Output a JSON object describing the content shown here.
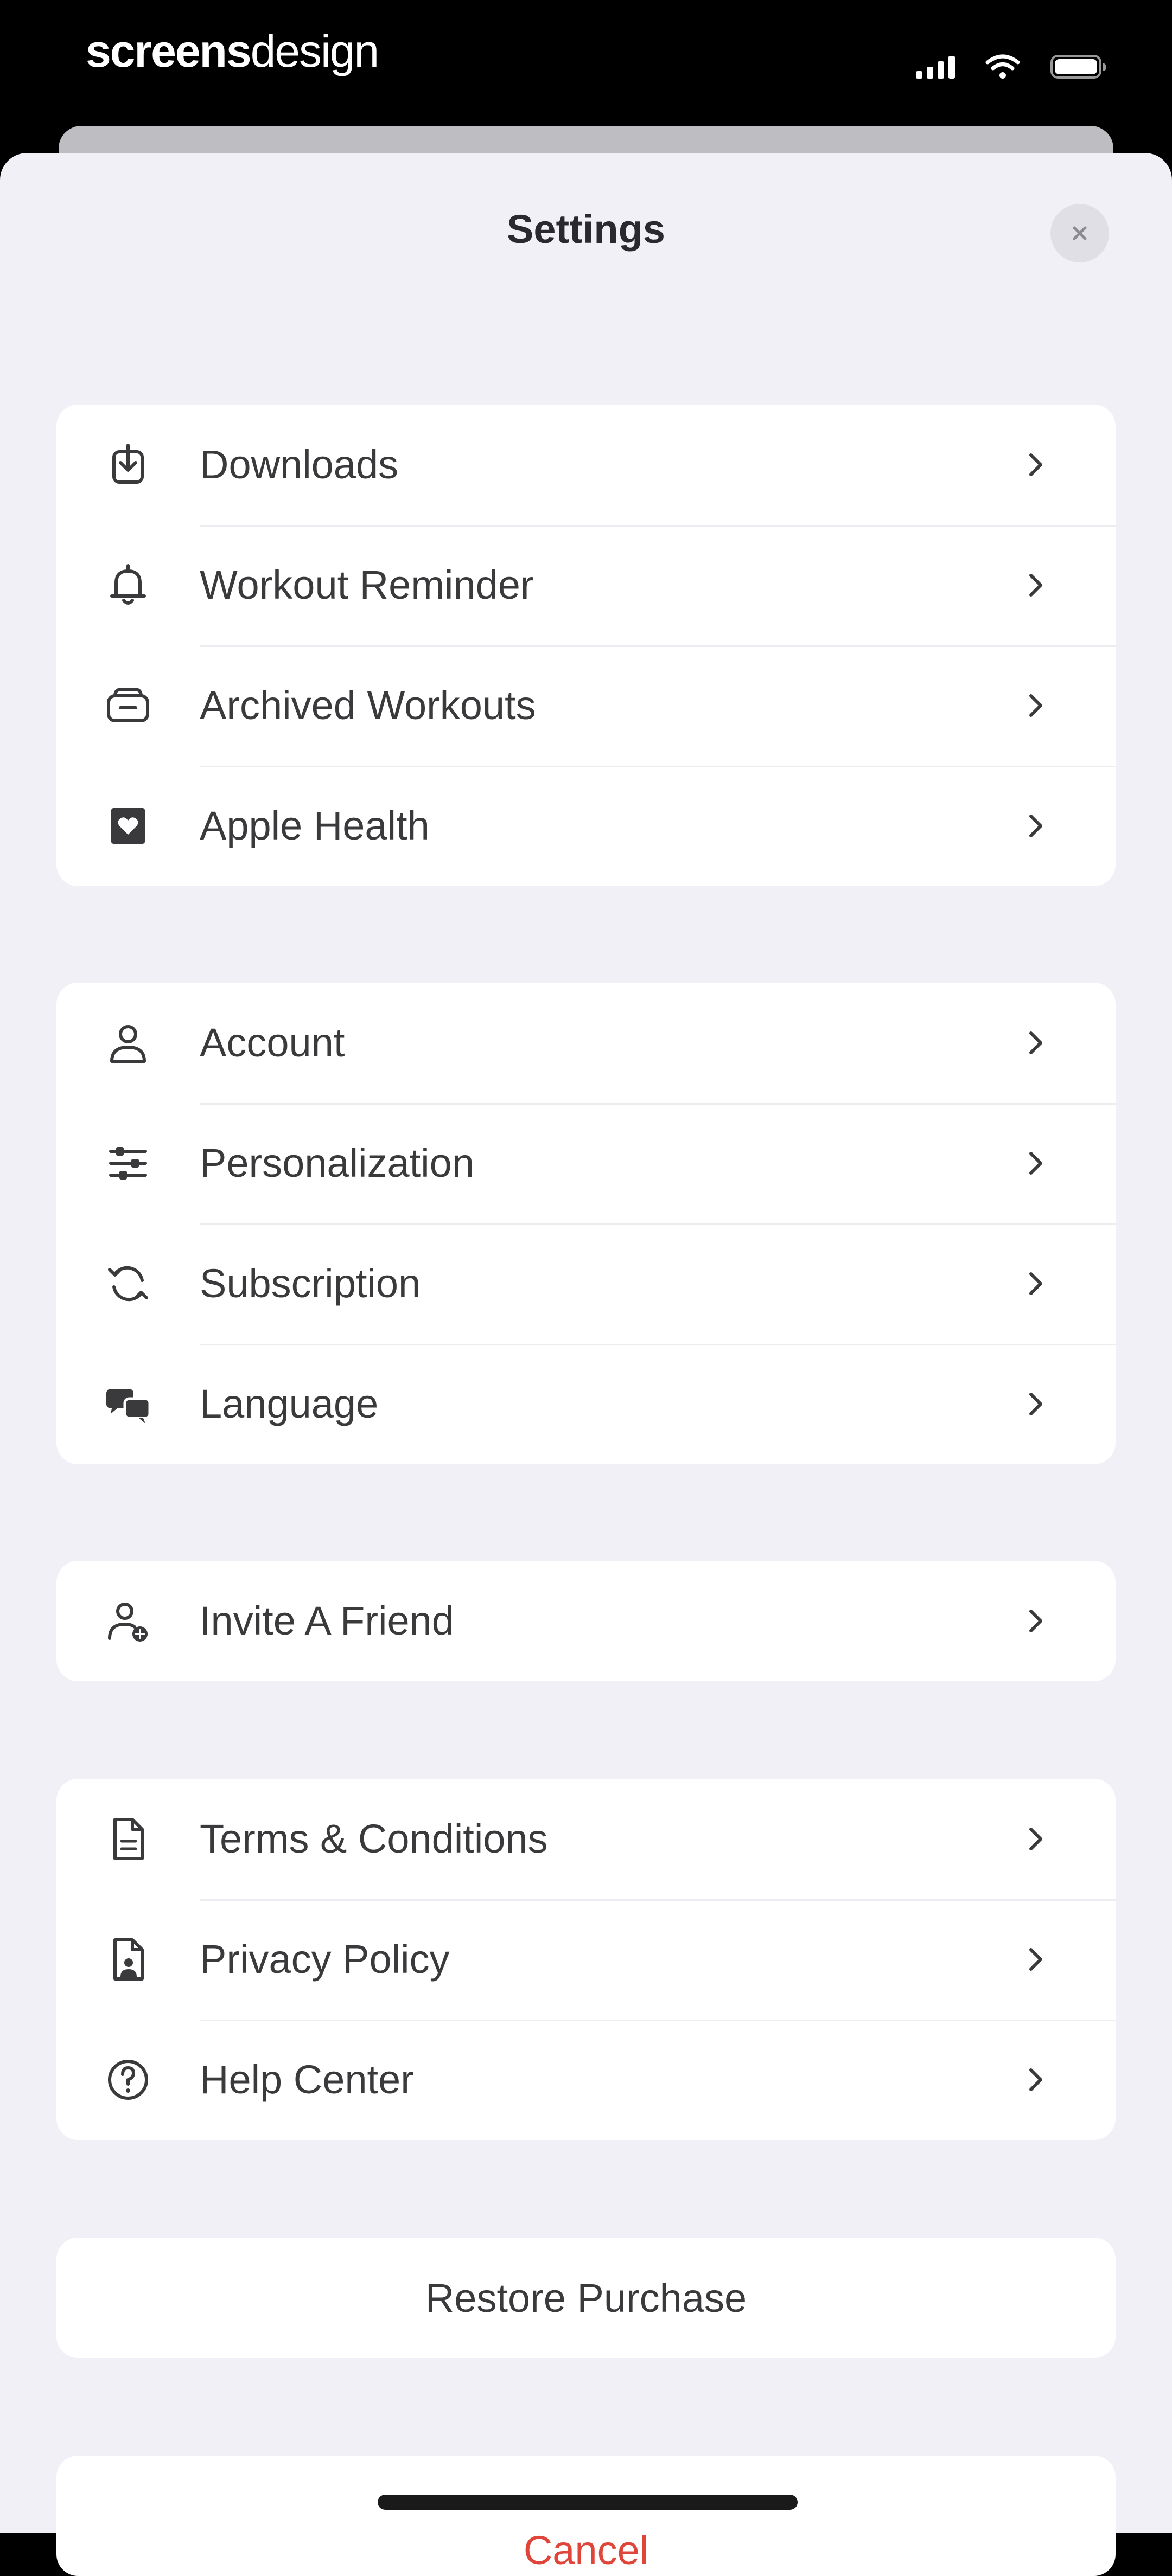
{
  "status_bar": {
    "brand_bold": "screens",
    "brand_light": "design"
  },
  "header": {
    "title": "Settings"
  },
  "groups": [
    {
      "items": [
        {
          "label": "Downloads",
          "icon": "download-icon"
        },
        {
          "label": "Workout Reminder",
          "icon": "bell-icon"
        },
        {
          "label": "Archived Workouts",
          "icon": "archive-box-icon"
        },
        {
          "label": "Apple Health",
          "icon": "heart-icon"
        }
      ]
    },
    {
      "items": [
        {
          "label": "Account",
          "icon": "person-icon"
        },
        {
          "label": "Personalization",
          "icon": "sliders-icon"
        },
        {
          "label": "Subscription",
          "icon": "refresh-icon"
        },
        {
          "label": "Language",
          "icon": "speech-bubbles-icon"
        }
      ]
    },
    {
      "items": [
        {
          "label": "Invite A Friend",
          "icon": "add-person-icon"
        }
      ]
    },
    {
      "items": [
        {
          "label": "Terms & Conditions",
          "icon": "document-icon"
        },
        {
          "label": "Privacy Policy",
          "icon": "privacy-document-icon"
        },
        {
          "label": "Help Center",
          "icon": "question-circle-icon"
        }
      ]
    }
  ],
  "restore_label": "Restore Purchase",
  "cancel_label": "Cancel",
  "colors": {
    "background": "#f1f0f7",
    "card": "#ffffff",
    "text": "#3a3a3c",
    "destructive": "#e0453a"
  }
}
